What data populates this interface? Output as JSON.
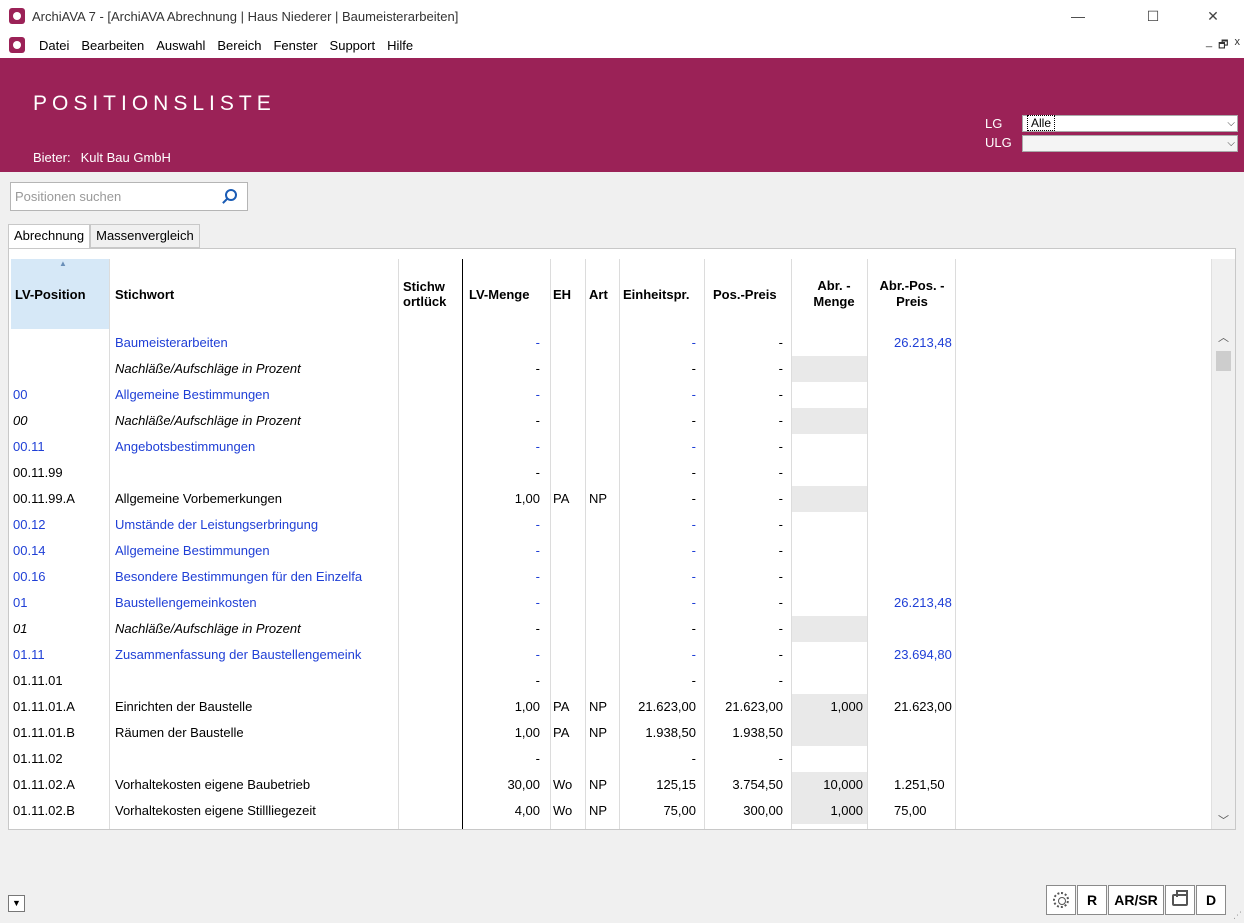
{
  "window": {
    "title": "ArchiAVA 7 - [ArchiAVA Abrechnung | Haus Niederer | Baumeisterarbeiten]",
    "minimize": "—",
    "maximize": "☐",
    "close": "✕"
  },
  "menu": {
    "items": [
      "Datei",
      "Bearbeiten",
      "Auswahl",
      "Bereich",
      "Fenster",
      "Support",
      "Hilfe"
    ],
    "mdi": [
      "_",
      "🗗",
      "x"
    ]
  },
  "header": {
    "title": "POSITIONSLISTE",
    "bidder_label": "Bieter:",
    "bidder_value": "Kult Bau GmbH",
    "lg_label": "LG",
    "lg_value": "Alle",
    "ulg_label": "ULG",
    "ulg_value": ""
  },
  "search": {
    "placeholder": "Positionen suchen"
  },
  "tabs": [
    "Abrechnung",
    "Massenvergleich"
  ],
  "columns": {
    "lv_position": "LV-Position",
    "stichwort": "Stichwort",
    "stichwortlueck": "Stichw ortlück",
    "lv_menge": "LV-Menge",
    "eh": "EH",
    "art": "Art",
    "einheitspr": "Einheitspr.",
    "pos_preis": "Pos.-Preis",
    "abr_menge": "Abr. -Menge",
    "abr_pos_preis": "Abr.-Pos. -Preis"
  },
  "rows": [
    {
      "pos": "",
      "stichwort": "Baumeisterarbeiten",
      "menge": "-",
      "eh": "",
      "art": "",
      "ep": "-",
      "pp": "-",
      "abr_menge": "",
      "abr_pp": "26.213,48",
      "link": true,
      "italic": false,
      "gray": false
    },
    {
      "pos": "",
      "stichwort": "Nachläße/Aufschläge in Prozent",
      "menge": "-",
      "eh": "",
      "art": "",
      "ep": "-",
      "pp": "-",
      "abr_menge": "",
      "abr_pp": "",
      "link": false,
      "italic": true,
      "gray": true
    },
    {
      "pos": "00",
      "stichwort": "Allgemeine Bestimmungen",
      "menge": "-",
      "eh": "",
      "art": "",
      "ep": "-",
      "pp": "-",
      "abr_menge": "",
      "abr_pp": "",
      "link": true,
      "italic": false,
      "gray": false
    },
    {
      "pos": "00",
      "stichwort": "Nachläße/Aufschläge in Prozent",
      "menge": "-",
      "eh": "",
      "art": "",
      "ep": "-",
      "pp": "-",
      "abr_menge": "",
      "abr_pp": "",
      "link": false,
      "italic": true,
      "gray": true
    },
    {
      "pos": "00.11",
      "stichwort": "Angebotsbestimmungen",
      "menge": "-",
      "eh": "",
      "art": "",
      "ep": "-",
      "pp": "-",
      "abr_menge": "",
      "abr_pp": "",
      "link": true,
      "italic": false,
      "gray": false
    },
    {
      "pos": "00.11.99",
      "stichwort": "",
      "menge": "-",
      "eh": "",
      "art": "",
      "ep": "-",
      "pp": "-",
      "abr_menge": "",
      "abr_pp": "",
      "link": false,
      "italic": false,
      "gray": false
    },
    {
      "pos": "00.11.99.A",
      "stichwort": "Allgemeine Vorbemerkungen",
      "menge": "1,00",
      "eh": "PA",
      "art": "NP",
      "ep": "-",
      "pp": "-",
      "abr_menge": "",
      "abr_pp": "",
      "link": false,
      "italic": false,
      "gray": true
    },
    {
      "pos": "00.12",
      "stichwort": "Umstände der Leistungserbringung",
      "menge": "-",
      "eh": "",
      "art": "",
      "ep": "-",
      "pp": "-",
      "abr_menge": "",
      "abr_pp": "",
      "link": true,
      "italic": false,
      "gray": false
    },
    {
      "pos": "00.14",
      "stichwort": "Allgemeine Bestimmungen",
      "menge": "-",
      "eh": "",
      "art": "",
      "ep": "-",
      "pp": "-",
      "abr_menge": "",
      "abr_pp": "",
      "link": true,
      "italic": false,
      "gray": false
    },
    {
      "pos": "00.16",
      "stichwort": "Besondere Bestimmungen für den Einzelfa",
      "menge": "-",
      "eh": "",
      "art": "",
      "ep": "-",
      "pp": "-",
      "abr_menge": "",
      "abr_pp": "",
      "link": true,
      "italic": false,
      "gray": false
    },
    {
      "pos": "01",
      "stichwort": "Baustellengemeinkosten",
      "menge": "-",
      "eh": "",
      "art": "",
      "ep": "-",
      "pp": "-",
      "abr_menge": "",
      "abr_pp": "26.213,48",
      "link": true,
      "italic": false,
      "gray": false
    },
    {
      "pos": "01",
      "stichwort": "Nachläße/Aufschläge in Prozent",
      "menge": "-",
      "eh": "",
      "art": "",
      "ep": "-",
      "pp": "-",
      "abr_menge": "",
      "abr_pp": "",
      "link": false,
      "italic": true,
      "gray": true
    },
    {
      "pos": "01.11",
      "stichwort": "Zusammenfassung der Baustellengemeink",
      "menge": "-",
      "eh": "",
      "art": "",
      "ep": "-",
      "pp": "-",
      "abr_menge": "",
      "abr_pp": "23.694,80",
      "link": true,
      "italic": false,
      "gray": false
    },
    {
      "pos": "01.11.01",
      "stichwort": "",
      "menge": "-",
      "eh": "",
      "art": "",
      "ep": "-",
      "pp": "-",
      "abr_menge": "",
      "abr_pp": "",
      "link": false,
      "italic": false,
      "gray": false
    },
    {
      "pos": "01.11.01.A",
      "stichwort": "Einrichten der Baustelle",
      "menge": "1,00",
      "eh": "PA",
      "art": "NP",
      "ep": "21.623,00",
      "pp": "21.623,00",
      "abr_menge": "1,000",
      "abr_pp": "21.623,00",
      "link": false,
      "italic": false,
      "gray": true
    },
    {
      "pos": "01.11.01.B",
      "stichwort": "Räumen der Baustelle",
      "menge": "1,00",
      "eh": "PA",
      "art": "NP",
      "ep": "1.938,50",
      "pp": "1.938,50",
      "abr_menge": "",
      "abr_pp": "",
      "link": false,
      "italic": false,
      "gray": true
    },
    {
      "pos": "01.11.02",
      "stichwort": "",
      "menge": "-",
      "eh": "",
      "art": "",
      "ep": "-",
      "pp": "-",
      "abr_menge": "",
      "abr_pp": "",
      "link": false,
      "italic": false,
      "gray": false
    },
    {
      "pos": "01.11.02.A",
      "stichwort": "Vorhaltekosten eigene Baubetrieb",
      "menge": "30,00",
      "eh": "Wo",
      "art": "NP",
      "ep": "125,15",
      "pp": "3.754,50",
      "abr_menge": "10,000",
      "abr_pp": "1.251,50",
      "link": false,
      "italic": false,
      "gray": true
    },
    {
      "pos": "01.11.02.B",
      "stichwort": "Vorhaltekosten eigene Stillliegezeit",
      "menge": "4,00",
      "eh": "Wo",
      "art": "NP",
      "ep": "75,00",
      "pp": "300,00",
      "abr_menge": "1,000",
      "abr_pp": "75,00",
      "link": false,
      "italic": false,
      "gray": true
    }
  ],
  "bottom": {
    "r_label": "R",
    "arsr_label": "AR/SR",
    "d_label": "D"
  },
  "colors": {
    "brand": "#9b2257",
    "link": "#1f3fd6",
    "header_sel": "#d6e8f7"
  }
}
